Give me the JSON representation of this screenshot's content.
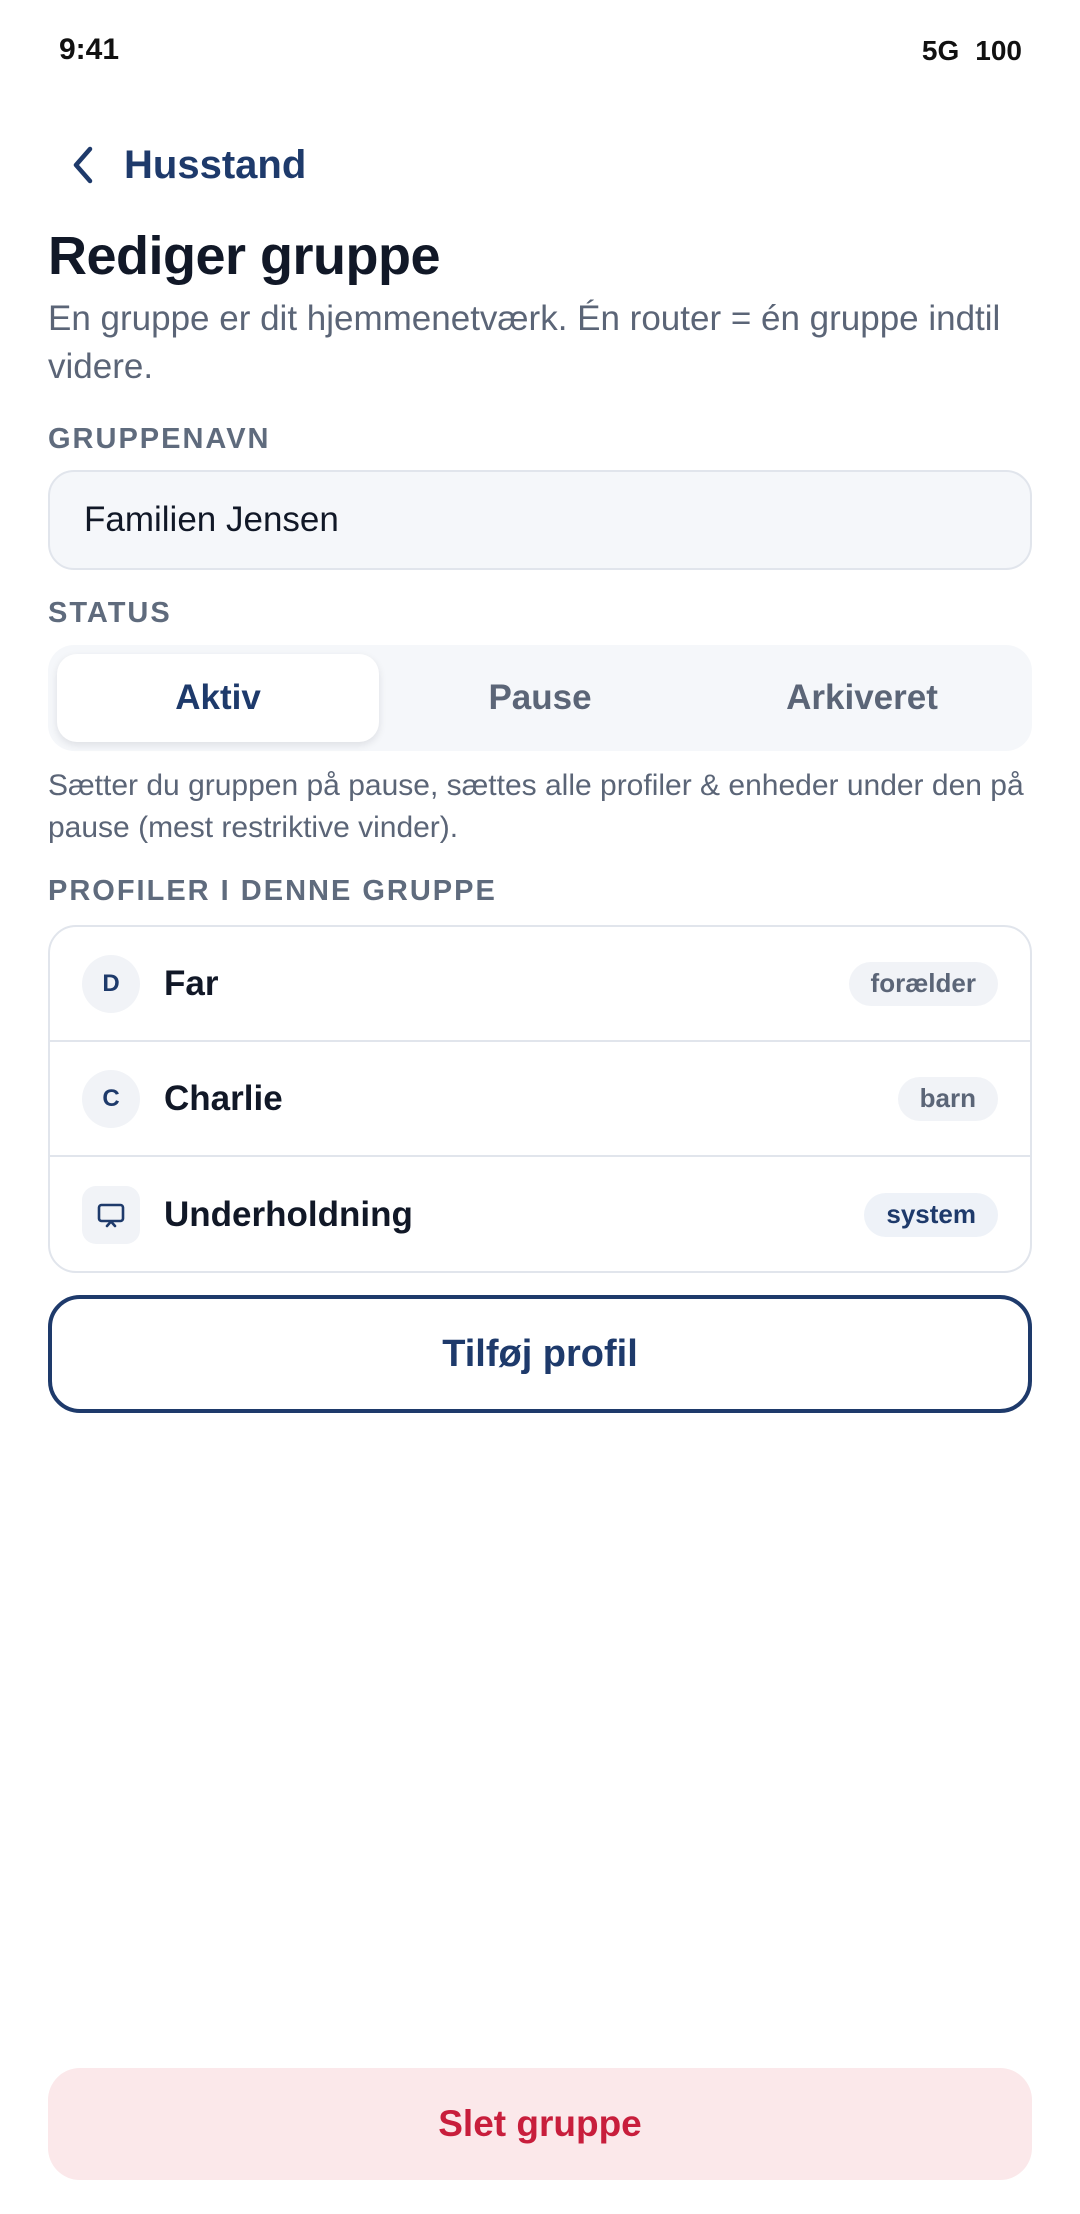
{
  "status_bar": {
    "time": "9:41",
    "network": "5G",
    "battery": "100"
  },
  "nav": {
    "back_label": "Husstand"
  },
  "header": {
    "title": "Rediger gruppe",
    "description": "En gruppe er dit hjemmenetværk. Én router = én gruppe indtil videre."
  },
  "group_name": {
    "label": "GRUPPENAVN",
    "value": "Familien Jensen"
  },
  "status": {
    "label": "STATUS",
    "options": [
      "Aktiv",
      "Pause",
      "Arkiveret"
    ],
    "selected": "Aktiv",
    "note": "Sætter du gruppen på pause, sættes alle profiler & enheder under den på pause (mest restriktive vinder)."
  },
  "profiles": {
    "label": "PROFILER I DENNE GRUPPE",
    "items": [
      {
        "initial": "D",
        "name": "Far",
        "role": "forælder",
        "icon": ""
      },
      {
        "initial": "C",
        "name": "Charlie",
        "role": "barn",
        "icon": ""
      },
      {
        "initial": "",
        "name": "Underholdning",
        "role": "system",
        "icon": "tv-icon"
      }
    ]
  },
  "actions": {
    "add_profile": "Tilføj profil",
    "delete_group": "Slet gruppe"
  },
  "colors": {
    "primary": "#1e3a6b",
    "danger": "#c81e3c",
    "danger_bg": "#fbe8ea",
    "muted": "#5b6577"
  }
}
